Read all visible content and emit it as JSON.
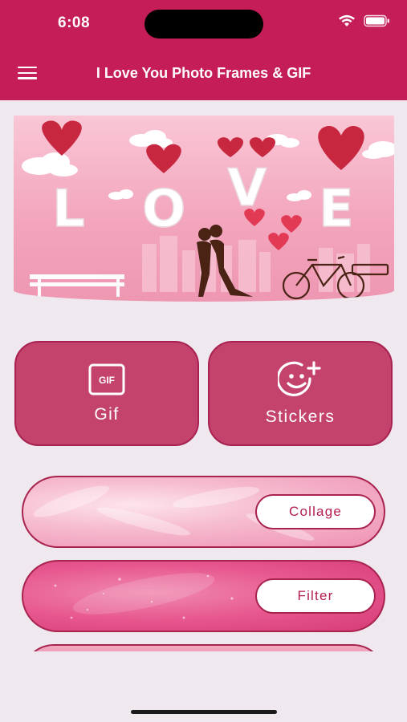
{
  "status_bar": {
    "time": "6:08"
  },
  "app_bar": {
    "title": "I Love You Photo Frames & GIF",
    "menu_icon": "hamburger-menu-icon"
  },
  "banner": {
    "letters": [
      "L",
      "O",
      "V",
      "E"
    ]
  },
  "cards": [
    {
      "label": "Gif",
      "icon": "gif-icon",
      "icon_text": "GIF"
    },
    {
      "label": "Stickers",
      "icon": "sticker-add-icon"
    }
  ],
  "pills": [
    {
      "button_label": "Collage"
    },
    {
      "button_label": "Filter"
    }
  ],
  "colors": {
    "primary": "#c51d58",
    "card": "#c3436d",
    "background": "#efe8ee"
  }
}
